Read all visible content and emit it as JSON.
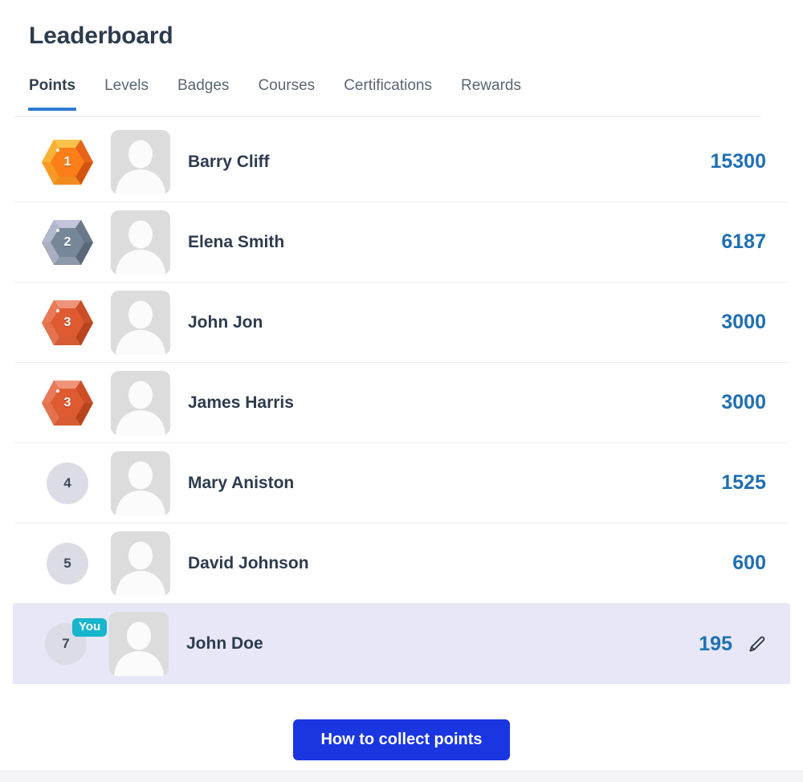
{
  "page": {
    "title": "Leaderboard"
  },
  "tabs": [
    {
      "label": "Points",
      "active": true
    },
    {
      "label": "Levels",
      "active": false
    },
    {
      "label": "Badges",
      "active": false
    },
    {
      "label": "Courses",
      "active": false
    },
    {
      "label": "Certifications",
      "active": false
    },
    {
      "label": "Rewards",
      "active": false
    }
  ],
  "colors": {
    "active_tab_underline": "#2e7ad1",
    "points_blue": "#1f6fb2",
    "name_navy": "#2d3b4e",
    "you_badge_teal": "#17b6cc",
    "you_row_background": "#e7e7f8",
    "cta_blue": "#1a36e0",
    "gold_badge": "#f97316",
    "silver_badge": "#7b8a9c",
    "bronze_badge": "#dd5b35",
    "plain_rank_circle": "#dcdce6"
  },
  "rows": [
    {
      "rank": "1",
      "badge_type": "hex-gold",
      "name": "Barry Cliff",
      "points": "15300",
      "avatar": "avatar-placeholder",
      "is_you": false,
      "editable": false
    },
    {
      "rank": "2",
      "badge_type": "hex-silver",
      "name": "Elena Smith",
      "points": "6187",
      "avatar": "avatar-placeholder",
      "is_you": false,
      "editable": false
    },
    {
      "rank": "3",
      "badge_type": "hex-bronze",
      "name": "John Jon",
      "points": "3000",
      "avatar": "avatar-placeholder",
      "is_you": false,
      "editable": false
    },
    {
      "rank": "3",
      "badge_type": "hex-bronze",
      "name": "James Harris",
      "points": "3000",
      "avatar": "avatar-placeholder",
      "is_you": false,
      "editable": false
    },
    {
      "rank": "4",
      "badge_type": "circle",
      "name": "Mary Aniston",
      "points": "1525",
      "avatar": "avatar-placeholder",
      "is_you": false,
      "editable": false
    },
    {
      "rank": "5",
      "badge_type": "circle",
      "name": "David Johnson",
      "points": "600",
      "avatar": "avatar-placeholder",
      "is_you": false,
      "editable": false
    },
    {
      "rank": "7",
      "badge_type": "circle",
      "name": "John Doe",
      "points": "195",
      "avatar": "avatar-placeholder",
      "is_you": true,
      "you_label": "You",
      "editable": true
    }
  ],
  "footer": {
    "cta_label": "How to collect points"
  }
}
